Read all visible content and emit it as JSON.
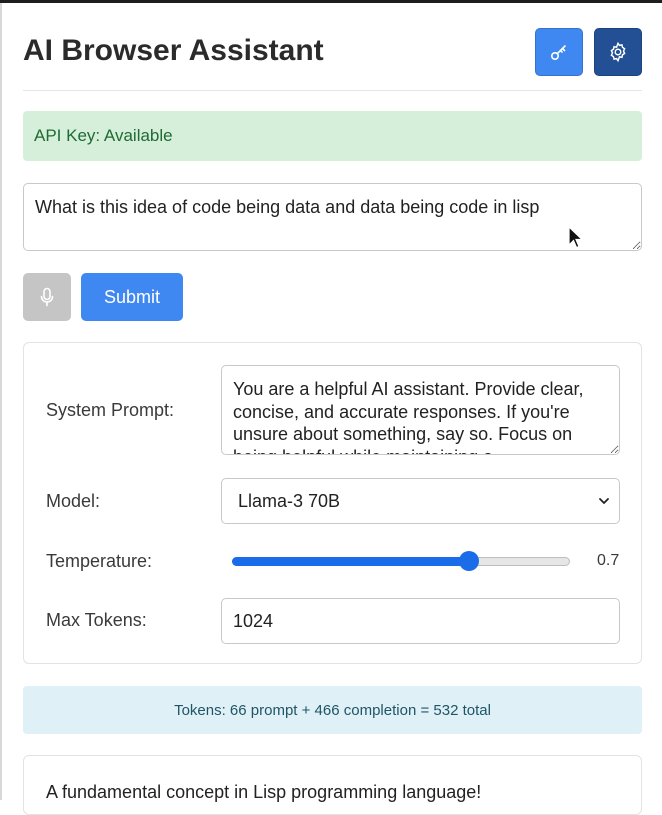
{
  "header": {
    "title": "AI Browser Assistant",
    "key_icon": "key-icon",
    "settings_icon": "gear-icon"
  },
  "status": {
    "text": "API Key: Available"
  },
  "query": {
    "value": "What is this idea of code being data and data being code in lisp"
  },
  "actions": {
    "mic_icon": "microphone-icon",
    "submit_label": "Submit"
  },
  "settings": {
    "system_prompt_label": "System Prompt:",
    "system_prompt_value": "You are a helpful AI assistant. Provide clear, concise, and accurate responses. If you're unsure about something, say so. Focus on being helpful while maintaining a",
    "model_label": "Model:",
    "model_value": "Llama-3 70B",
    "temperature_label": "Temperature:",
    "temperature_value": "0.7",
    "temperature_fraction": 0.7,
    "max_tokens_label": "Max Tokens:",
    "max_tokens_value": "1024"
  },
  "token_info": {
    "text": "Tokens: 66 prompt + 466 completion = 532 total"
  },
  "response": {
    "text": "A fundamental concept in Lisp programming language!"
  },
  "colors": {
    "primary": "#3f87f1",
    "primary_dark": "#234f95",
    "success_bg": "#d6efdb",
    "success_text": "#1f6b33",
    "info_bg": "#dff0f6",
    "slider": "#1a6ce8"
  }
}
